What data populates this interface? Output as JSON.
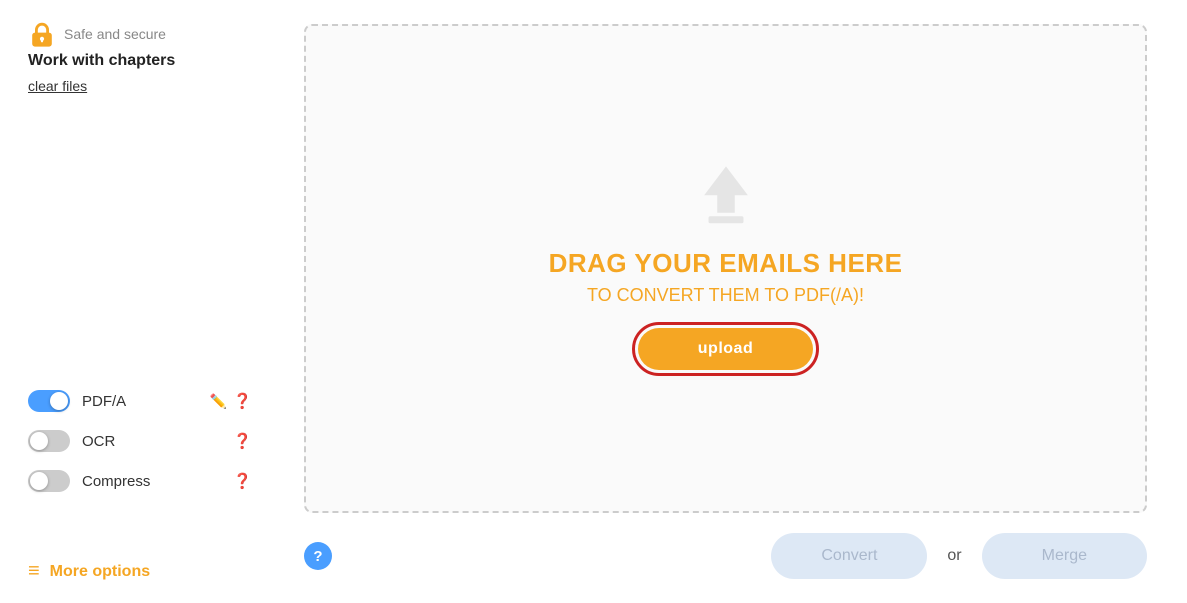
{
  "header": {
    "safe_text": "Safe and secure",
    "title": "Work with chapters",
    "clear_files_label": "clear files"
  },
  "options": [
    {
      "id": "pdfa",
      "label": "PDF/A",
      "enabled": true,
      "has_pencil": true,
      "has_question": true
    },
    {
      "id": "ocr",
      "label": "OCR",
      "enabled": false,
      "has_pencil": false,
      "has_question": true
    },
    {
      "id": "compress",
      "label": "Compress",
      "enabled": false,
      "has_pencil": false,
      "has_question": true
    }
  ],
  "more_options": {
    "label": "More options"
  },
  "drop_zone": {
    "drag_main": "DRAG YOUR EMAILS HERE",
    "drag_sub": "TO CONVERT THEM TO PDF(/A)!",
    "upload_label": "upload"
  },
  "bottom_bar": {
    "convert_label": "Convert",
    "or_label": "or",
    "merge_label": "Merge"
  },
  "colors": {
    "orange": "#f5a623",
    "blue": "#4a9eff",
    "gray": "#ccc",
    "red": "#cc2222"
  }
}
